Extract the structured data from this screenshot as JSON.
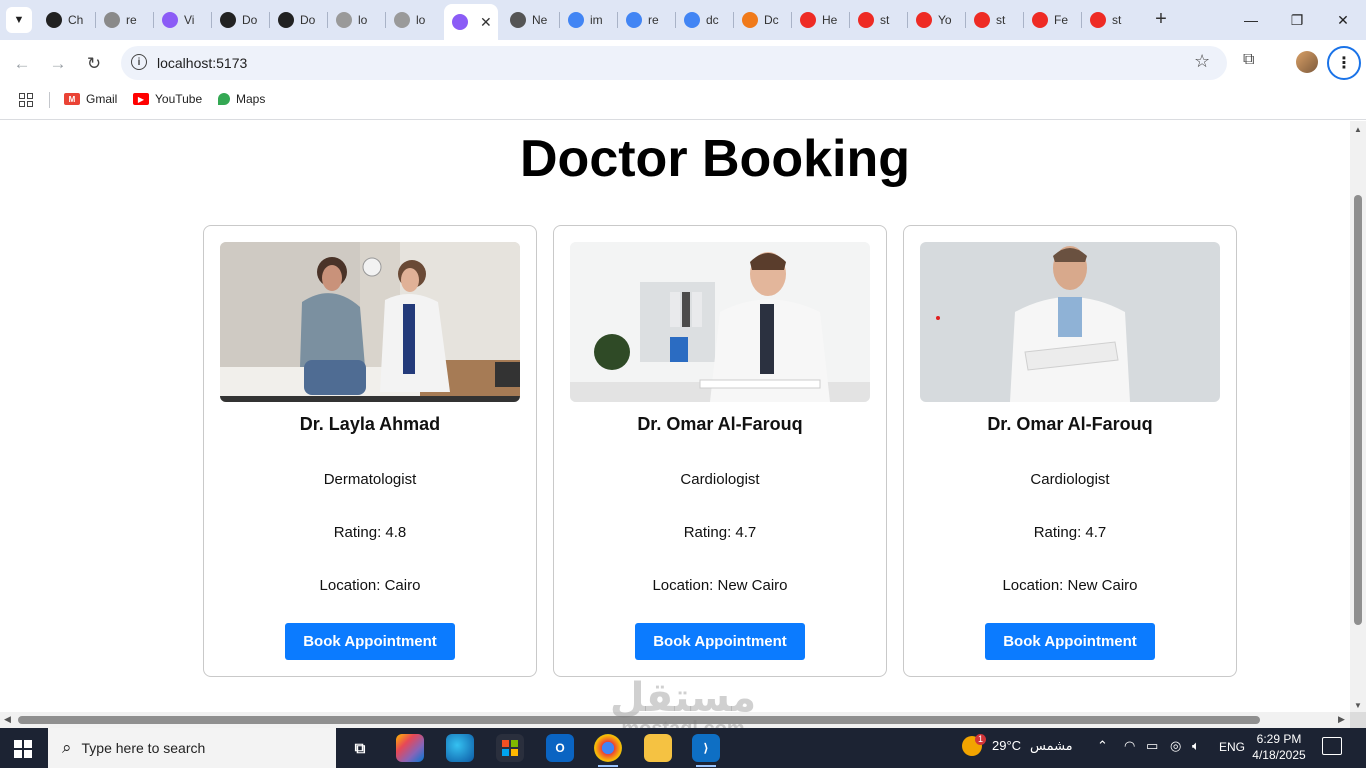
{
  "browser": {
    "tabs": [
      {
        "title": "Ch",
        "icon": "openai-icon",
        "color": "#222"
      },
      {
        "title": "re",
        "icon": "react-icon",
        "color": "#8a8a8a"
      },
      {
        "title": "Vi",
        "icon": "vite-icon",
        "color": "#8b5cf6"
      },
      {
        "title": "Do",
        "icon": "openai-icon",
        "color": "#222"
      },
      {
        "title": "Do",
        "icon": "openai-icon",
        "color": "#222"
      },
      {
        "title": "lo",
        "icon": "vite-icon",
        "color": "#9a9a9a"
      },
      {
        "title": "lo",
        "icon": "vite-icon",
        "color": "#9a9a9a"
      },
      {
        "title": "",
        "icon": "vite-icon",
        "color": "#8b5cf6"
      },
      {
        "title": "Ne",
        "icon": "globe-icon",
        "color": "#555"
      },
      {
        "title": "im",
        "icon": "google-icon",
        "color": "#4285f4"
      },
      {
        "title": "re",
        "icon": "google-icon",
        "color": "#4285f4"
      },
      {
        "title": "dc",
        "icon": "google-icon",
        "color": "#4285f4"
      },
      {
        "title": "Dc",
        "icon": "brave-icon",
        "color": "#f07a1a"
      },
      {
        "title": "He",
        "icon": "shutterstock-icon",
        "color": "#ee2b24"
      },
      {
        "title": "st",
        "icon": "shutterstock-icon",
        "color": "#ee2b24"
      },
      {
        "title": "Yo",
        "icon": "shutterstock-icon",
        "color": "#ee2b24"
      },
      {
        "title": "st",
        "icon": "shutterstock-icon",
        "color": "#ee2b24"
      },
      {
        "title": "Fe",
        "icon": "shutterstock-icon",
        "color": "#ee2b24"
      },
      {
        "title": "st",
        "icon": "shutterstock-icon",
        "color": "#ee2b24"
      }
    ],
    "url": "localhost:5173",
    "bookmarks": [
      {
        "label": "Gmail",
        "icon": "gmail-icon"
      },
      {
        "label": "YouTube",
        "icon": "youtube-icon"
      },
      {
        "label": "Maps",
        "icon": "maps-icon"
      }
    ]
  },
  "page": {
    "title": "Doctor Booking",
    "doctors": [
      {
        "name": "Dr. Layla Ahmad",
        "specialty": "Dermatologist",
        "rating": "Rating: 4.8",
        "location": "Location: Cairo",
        "button": "Book Appointment"
      },
      {
        "name": "Dr. Omar Al-Farouq",
        "specialty": "Cardiologist",
        "rating": "Rating: 4.7",
        "location": "Location: New Cairo",
        "button": "Book Appointment"
      },
      {
        "name": "Dr. Omar Al-Farouq",
        "specialty": "Cardiologist",
        "rating": "Rating: 4.7",
        "location": "Location: New Cairo",
        "button": "Book Appointment"
      }
    ],
    "accent_color": "#0b7bff"
  },
  "watermark": {
    "line1": "مستقل",
    "line2": "mostaql.com"
  },
  "taskbar": {
    "search_placeholder": "Type here to search",
    "weather_temp": "29°C",
    "weather_text": "مشمس",
    "language": "ENG",
    "time": "6:29 PM",
    "date": "4/18/2025",
    "weather_badge": "1"
  }
}
